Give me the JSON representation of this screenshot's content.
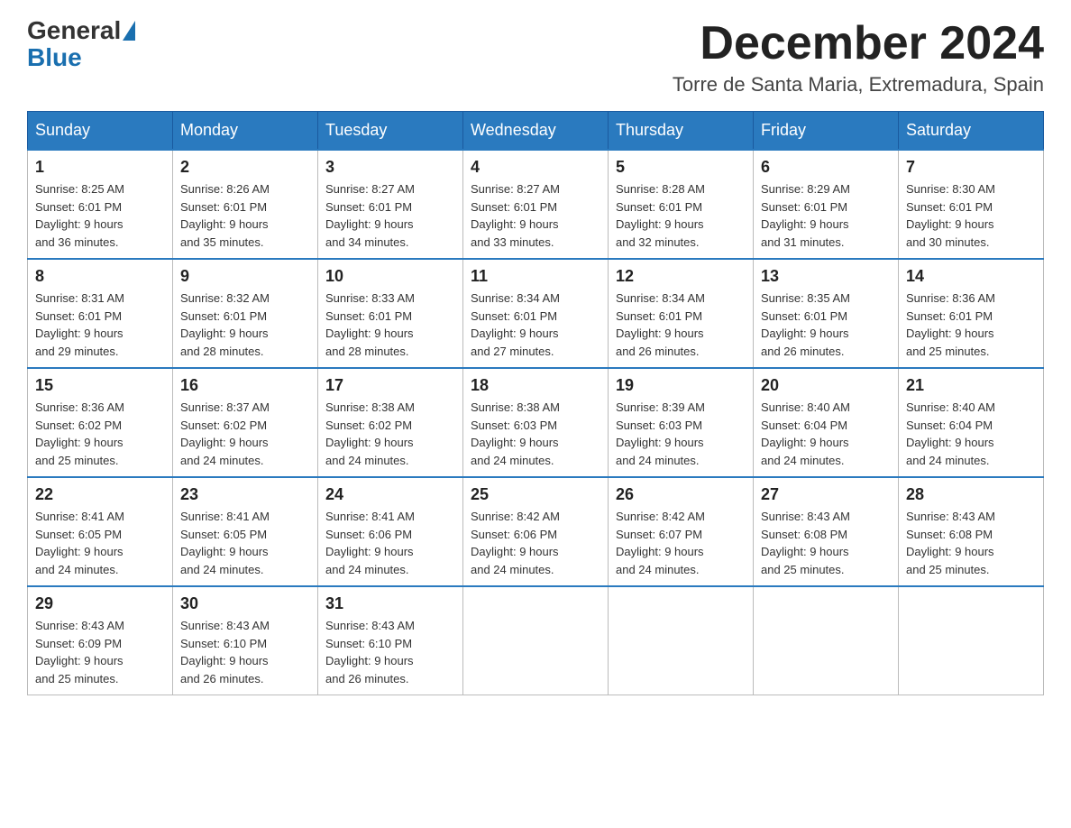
{
  "header": {
    "logo": {
      "general": "General",
      "blue": "Blue"
    },
    "title": "December 2024",
    "location": "Torre de Santa Maria, Extremadura, Spain"
  },
  "days_of_week": [
    "Sunday",
    "Monday",
    "Tuesday",
    "Wednesday",
    "Thursday",
    "Friday",
    "Saturday"
  ],
  "weeks": [
    [
      {
        "day": "1",
        "sunrise": "8:25 AM",
        "sunset": "6:01 PM",
        "daylight": "9 hours and 36 minutes."
      },
      {
        "day": "2",
        "sunrise": "8:26 AM",
        "sunset": "6:01 PM",
        "daylight": "9 hours and 35 minutes."
      },
      {
        "day": "3",
        "sunrise": "8:27 AM",
        "sunset": "6:01 PM",
        "daylight": "9 hours and 34 minutes."
      },
      {
        "day": "4",
        "sunrise": "8:27 AM",
        "sunset": "6:01 PM",
        "daylight": "9 hours and 33 minutes."
      },
      {
        "day": "5",
        "sunrise": "8:28 AM",
        "sunset": "6:01 PM",
        "daylight": "9 hours and 32 minutes."
      },
      {
        "day": "6",
        "sunrise": "8:29 AM",
        "sunset": "6:01 PM",
        "daylight": "9 hours and 31 minutes."
      },
      {
        "day": "7",
        "sunrise": "8:30 AM",
        "sunset": "6:01 PM",
        "daylight": "9 hours and 30 minutes."
      }
    ],
    [
      {
        "day": "8",
        "sunrise": "8:31 AM",
        "sunset": "6:01 PM",
        "daylight": "9 hours and 29 minutes."
      },
      {
        "day": "9",
        "sunrise": "8:32 AM",
        "sunset": "6:01 PM",
        "daylight": "9 hours and 28 minutes."
      },
      {
        "day": "10",
        "sunrise": "8:33 AM",
        "sunset": "6:01 PM",
        "daylight": "9 hours and 28 minutes."
      },
      {
        "day": "11",
        "sunrise": "8:34 AM",
        "sunset": "6:01 PM",
        "daylight": "9 hours and 27 minutes."
      },
      {
        "day": "12",
        "sunrise": "8:34 AM",
        "sunset": "6:01 PM",
        "daylight": "9 hours and 26 minutes."
      },
      {
        "day": "13",
        "sunrise": "8:35 AM",
        "sunset": "6:01 PM",
        "daylight": "9 hours and 26 minutes."
      },
      {
        "day": "14",
        "sunrise": "8:36 AM",
        "sunset": "6:01 PM",
        "daylight": "9 hours and 25 minutes."
      }
    ],
    [
      {
        "day": "15",
        "sunrise": "8:36 AM",
        "sunset": "6:02 PM",
        "daylight": "9 hours and 25 minutes."
      },
      {
        "day": "16",
        "sunrise": "8:37 AM",
        "sunset": "6:02 PM",
        "daylight": "9 hours and 24 minutes."
      },
      {
        "day": "17",
        "sunrise": "8:38 AM",
        "sunset": "6:02 PM",
        "daylight": "9 hours and 24 minutes."
      },
      {
        "day": "18",
        "sunrise": "8:38 AM",
        "sunset": "6:03 PM",
        "daylight": "9 hours and 24 minutes."
      },
      {
        "day": "19",
        "sunrise": "8:39 AM",
        "sunset": "6:03 PM",
        "daylight": "9 hours and 24 minutes."
      },
      {
        "day": "20",
        "sunrise": "8:40 AM",
        "sunset": "6:04 PM",
        "daylight": "9 hours and 24 minutes."
      },
      {
        "day": "21",
        "sunrise": "8:40 AM",
        "sunset": "6:04 PM",
        "daylight": "9 hours and 24 minutes."
      }
    ],
    [
      {
        "day": "22",
        "sunrise": "8:41 AM",
        "sunset": "6:05 PM",
        "daylight": "9 hours and 24 minutes."
      },
      {
        "day": "23",
        "sunrise": "8:41 AM",
        "sunset": "6:05 PM",
        "daylight": "9 hours and 24 minutes."
      },
      {
        "day": "24",
        "sunrise": "8:41 AM",
        "sunset": "6:06 PM",
        "daylight": "9 hours and 24 minutes."
      },
      {
        "day": "25",
        "sunrise": "8:42 AM",
        "sunset": "6:06 PM",
        "daylight": "9 hours and 24 minutes."
      },
      {
        "day": "26",
        "sunrise": "8:42 AM",
        "sunset": "6:07 PM",
        "daylight": "9 hours and 24 minutes."
      },
      {
        "day": "27",
        "sunrise": "8:43 AM",
        "sunset": "6:08 PM",
        "daylight": "9 hours and 25 minutes."
      },
      {
        "day": "28",
        "sunrise": "8:43 AM",
        "sunset": "6:08 PM",
        "daylight": "9 hours and 25 minutes."
      }
    ],
    [
      {
        "day": "29",
        "sunrise": "8:43 AM",
        "sunset": "6:09 PM",
        "daylight": "9 hours and 25 minutes."
      },
      {
        "day": "30",
        "sunrise": "8:43 AM",
        "sunset": "6:10 PM",
        "daylight": "9 hours and 26 minutes."
      },
      {
        "day": "31",
        "sunrise": "8:43 AM",
        "sunset": "6:10 PM",
        "daylight": "9 hours and 26 minutes."
      },
      null,
      null,
      null,
      null
    ]
  ],
  "labels": {
    "sunrise": "Sunrise:",
    "sunset": "Sunset:",
    "daylight": "Daylight:"
  }
}
